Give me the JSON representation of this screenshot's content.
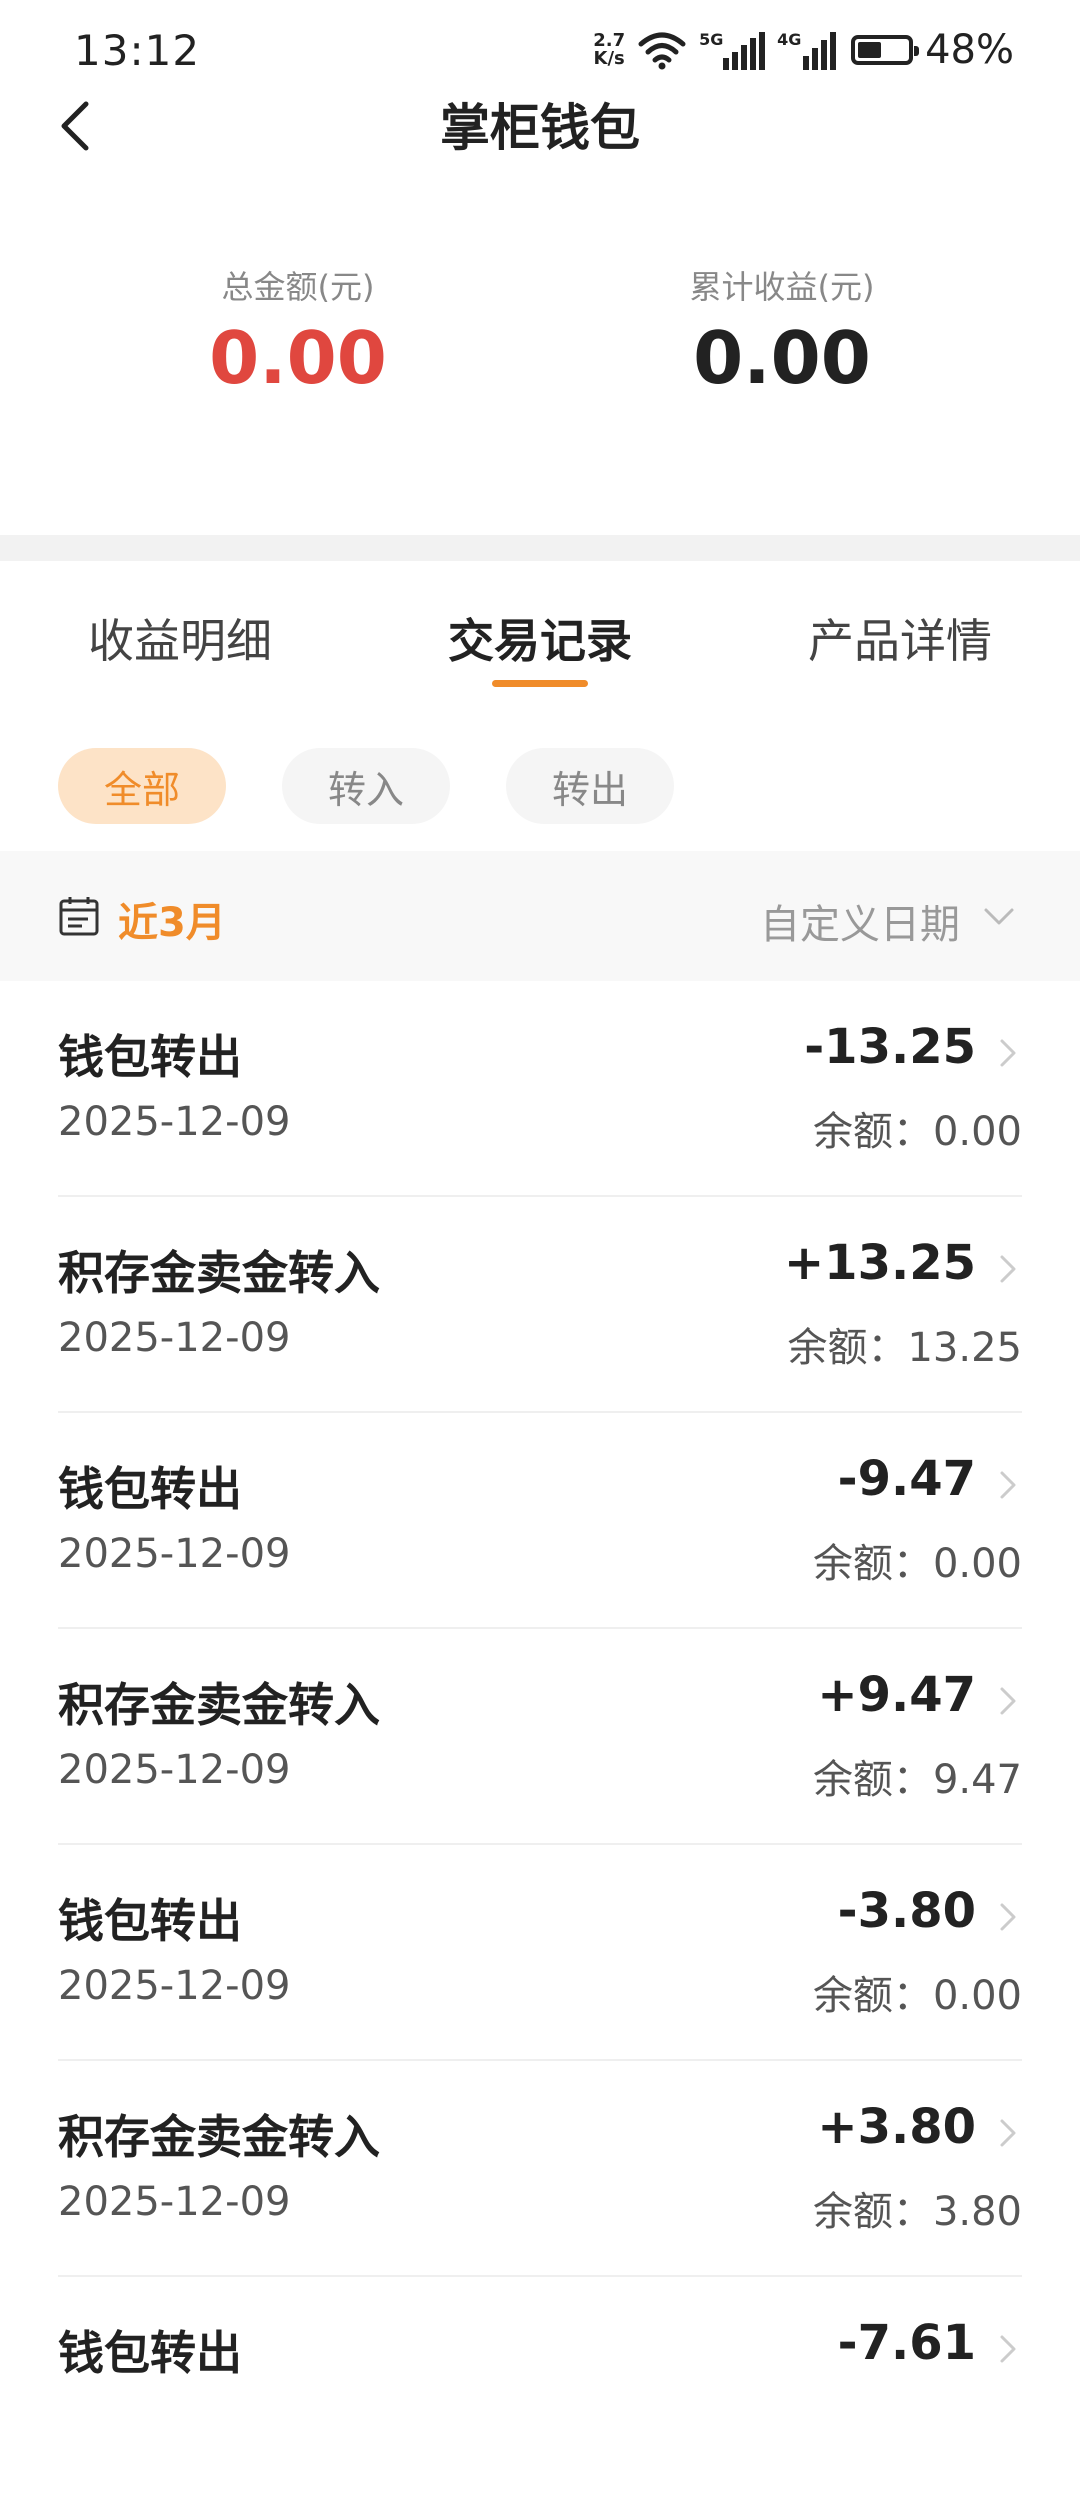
{
  "status_bar": {
    "time": "13:12",
    "net_speed_value": "2.7",
    "net_speed_unit": "K/s",
    "sig1_label": "5G",
    "sig2_label": "4G",
    "battery_percent": "48%",
    "battery_level": 0.48
  },
  "nav": {
    "title": "掌柜钱包"
  },
  "summary": {
    "total_label": "总金额(元)",
    "total_value": "0.00",
    "earnings_label": "累计收益(元)",
    "earnings_value": "0.00"
  },
  "tabs": [
    {
      "label": "收益明细"
    },
    {
      "label": "交易记录"
    },
    {
      "label": "产品详情"
    }
  ],
  "filters": [
    {
      "label": "全部"
    },
    {
      "label": "转入"
    },
    {
      "label": "转出"
    }
  ],
  "date_bar": {
    "range": "近3月",
    "custom": "自定义日期"
  },
  "balance_prefix": "余额：",
  "transactions": [
    {
      "title": "钱包转出",
      "date": "2025-12-09",
      "amount": "-13.25",
      "balance": "0.00"
    },
    {
      "title": "积存金卖金转入",
      "date": "2025-12-09",
      "amount": "+13.25",
      "balance": "13.25"
    },
    {
      "title": "钱包转出",
      "date": "2025-12-09",
      "amount": "-9.47",
      "balance": "0.00"
    },
    {
      "title": "积存金卖金转入",
      "date": "2025-12-09",
      "amount": "+9.47",
      "balance": "9.47"
    },
    {
      "title": "钱包转出",
      "date": "2025-12-09",
      "amount": "-3.80",
      "balance": "0.00"
    },
    {
      "title": "积存金卖金转入",
      "date": "2025-12-09",
      "amount": "+3.80",
      "balance": "3.80"
    },
    {
      "title": "钱包转出",
      "date": "",
      "amount": "-7.61",
      "balance": ""
    }
  ],
  "colors": {
    "accent": "#f08c2a",
    "total_red": "#e0473f",
    "text": "#222222"
  }
}
